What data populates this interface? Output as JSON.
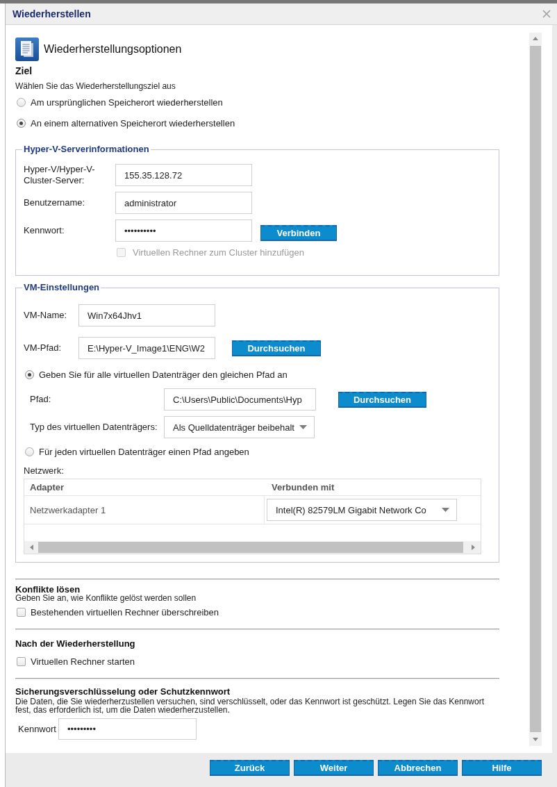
{
  "dialog": {
    "title": "Wiederherstellen"
  },
  "header": {
    "title": "Wiederherstellungsoptionen"
  },
  "destination": {
    "heading": "Ziel",
    "description": "Wählen Sie das Wiederherstellungsziel aus",
    "options": [
      {
        "label": "Am ursprünglichen Speicherort wiederherstellen",
        "selected": false
      },
      {
        "label": "An einem alternativen Speicherort wiederherstellen",
        "selected": true
      }
    ]
  },
  "server_info": {
    "legend": "Hyper-V-Serverinformationen",
    "fields": [
      {
        "label": "Hyper-V/Hyper-V-Cluster-Server:",
        "value": "155.35.128.72"
      },
      {
        "label": "Benutzername:",
        "value": "administrator"
      },
      {
        "label": "Kennwort:",
        "value": "••••••••••"
      }
    ],
    "connect_button": "Verbinden",
    "cluster_checkbox": {
      "label": "Virtuellen Rechner zum Cluster hinzufügen",
      "checked": false,
      "disabled": true
    }
  },
  "vm_settings": {
    "legend": "VM-Einstellungen",
    "vm_name": {
      "label": "VM-Name:",
      "value": "Win7x64Jhv1"
    },
    "vm_path": {
      "label": "VM-Pfad:",
      "value": "E:\\Hyper-V_Image1\\ENG\\W2",
      "button": "Durchsuchen"
    },
    "disk_modes": [
      {
        "label": "Geben Sie für alle virtuellen Datenträger den gleichen Pfad an",
        "selected": true
      },
      {
        "label": "Für jeden virtuellen Datenträger einen Pfad angeben",
        "selected": false
      }
    ],
    "path": {
      "label": "Pfad:",
      "value": "C:\\Users\\Public\\Documents\\Hyp",
      "button": "Durchsuchen"
    },
    "disk_type": {
      "label": "Typ des virtuellen Datenträgers:",
      "value": "Als Quelldatenträger beibehalt"
    },
    "network": {
      "label": "Netzwerk:",
      "columns": [
        "Adapter",
        "Verbunden mit"
      ],
      "rows": [
        {
          "adapter": "Netzwerkadapter 1",
          "connected_to": "Intel(R) 82579LM Gigabit Network Co"
        }
      ]
    }
  },
  "conflicts": {
    "heading": "Konflikte lösen",
    "description": "Geben Sie an, wie Konflikte gelöst werden sollen",
    "checkbox": {
      "label": "Bestehenden virtuellen Rechner überschreiben",
      "checked": false
    }
  },
  "post_restore": {
    "heading": "Nach der Wiederherstellung",
    "checkbox": {
      "label": "Virtuellen Rechner starten",
      "checked": false
    }
  },
  "encryption": {
    "heading": "Sicherungsverschlüsselung oder Schutzkennwort",
    "description": "Die Daten, die Sie wiederherzustellen versuchen, sind verschlüsselt, oder das Kennwort ist geschützt. Legen Sie das Kennwort fest, das erforderlich ist, um die Daten wiederherzustellen.",
    "password": {
      "label": "Kennwort",
      "value": "•••••••••"
    }
  },
  "buttons": [
    "Zurück",
    "Weiter",
    "Abbrechen",
    "Hilfe"
  ]
}
